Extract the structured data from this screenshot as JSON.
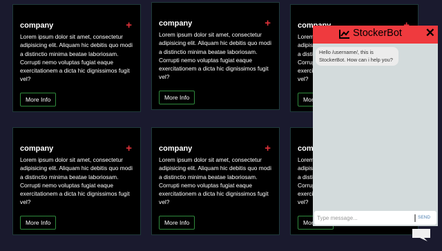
{
  "cards": [
    {
      "title": "company",
      "plus": "+",
      "body": "Lorem ipsum dolor sit amet, consectetur adipisicing elit. Aliquam hic debitis quo modi a distinctio minima beatae laboriosam. Corrupti nemo voluptas fugiat eaque exercitationem a dicta hic dignissimos fugit vel?",
      "button": "More Info"
    },
    {
      "title": "company",
      "plus": "+",
      "body": "Lorem ipsum dolor sit amet, consectetur adipisicing elit. Aliquam hic debitis quo modi a distinctio minima beatae laboriosam. Corrupti nemo voluptas fugiat eaque exercitationem a dicta hic dignissimos fugit vel?",
      "button": "More Info"
    },
    {
      "title": "company",
      "plus": "+",
      "body": "Lorem ipsum dolor sit amet, consectetur adipisicing elit. Aliquam hic debitis quo modi a distinctio minima beatae laboriosam. Corrupti nemo voluptas fugiat eaque exercitationem a dicta hic dignissimos fugit vel?",
      "button": "More Info"
    },
    {
      "title": "company",
      "plus": "+",
      "body": "Lorem ipsum dolor sit amet, consectetur adipisicing elit. Aliquam hic debitis quo modi a distinctio minima beatae laboriosam. Corrupti nemo voluptas fugiat eaque exercitationem a dicta hic dignissimos fugit vel?",
      "button": "More Info"
    },
    {
      "title": "company",
      "plus": "+",
      "body": "Lorem ipsum dolor sit amet, consectetur adipisicing elit. Aliquam hic debitis quo modi a distinctio minima beatae laboriosam. Corrupti nemo voluptas fugiat eaque exercitationem a dicta hic dignissimos fugit vel?",
      "button": "More Info"
    },
    {
      "title": "company",
      "plus": "+",
      "body": "Lorem ipsum dolor sit amet, consectetur adipisicing elit. Aliquam hic debitis quo modi a distinctio minima beatae laboriosam. Corrupti nemo voluptas fugiat eaque exercitationem a dicta hic dignissimos fugit vel?",
      "button": "More Info"
    }
  ],
  "chatbot": {
    "title": "StockerBot",
    "close": "✕",
    "message": "Hello /username/, this is StockerBot. How can i help you?",
    "input_placeholder": "Type message...",
    "send_label": "SEND",
    "header_icon": "line-chart-icon",
    "toggle_icon": "chat-bubble-icon"
  },
  "colors": {
    "page_background": "#1a1a2e",
    "card_background": "#000000",
    "accent_red": "#ef3a3e",
    "button_border": "#2f8a3c",
    "chat_background": "#d3dbdc"
  }
}
